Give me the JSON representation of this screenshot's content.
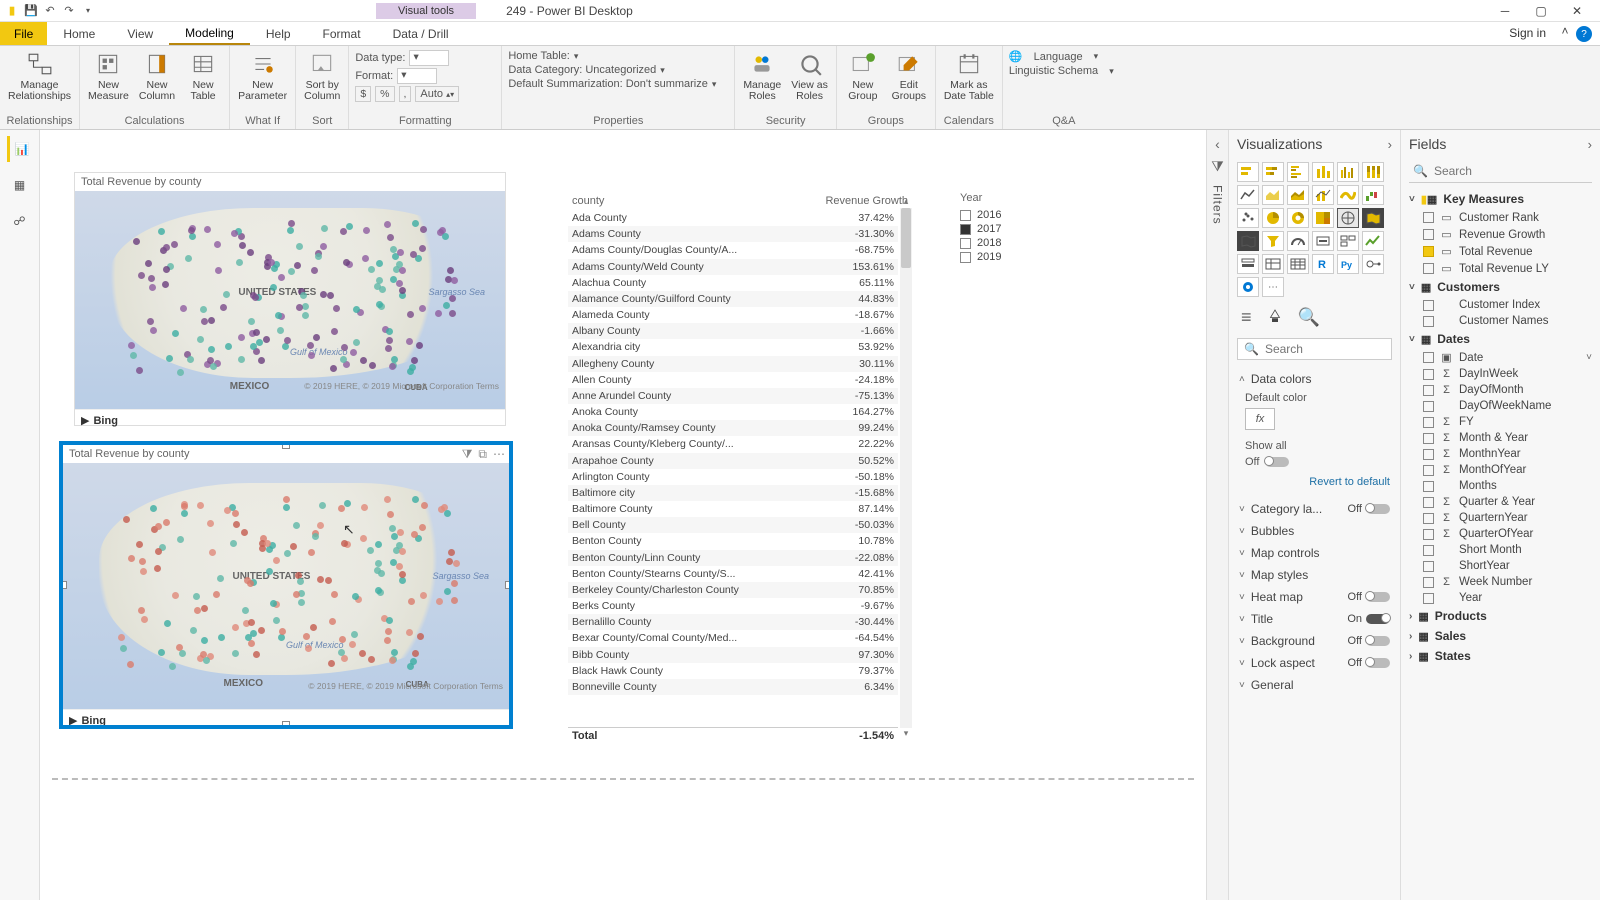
{
  "app_title": "249 - Power BI Desktop",
  "context_tab": "Visual tools",
  "signin": "Sign in",
  "menus": [
    "Home",
    "View",
    "Modeling",
    "Help",
    "Format",
    "Data / Drill"
  ],
  "active_menu": 2,
  "file_label": "File",
  "ribbon": {
    "relationships": {
      "btn": "Manage\nRelationships",
      "label": "Relationships"
    },
    "calculations": {
      "measure": "New\nMeasure",
      "column": "New\nColumn",
      "table": "New\nTable",
      "label": "Calculations"
    },
    "whatif": {
      "btn": "New\nParameter",
      "label": "What If"
    },
    "sort": {
      "btn": "Sort by\nColumn",
      "label": "Sort"
    },
    "formatting": {
      "dt": "Data type:",
      "fmt": "Format:",
      "cur": "$",
      "pct": "%",
      "comma": ",",
      "auto": "Auto",
      "label": "Formatting"
    },
    "properties": {
      "ht": "Home Table:",
      "dc": "Data Category: Uncategorized",
      "ds": "Default Summarization: Don't summarize",
      "label": "Properties"
    },
    "security": {
      "roles": "Manage\nRoles",
      "viewas": "View as\nRoles",
      "label": "Security"
    },
    "groups": {
      "new": "New\nGroup",
      "edit": "Edit\nGroups",
      "label": "Groups"
    },
    "calendars": {
      "btn": "Mark as\nDate Table",
      "label": "Calendars"
    },
    "qa": {
      "lang": "Language",
      "schema": "Linguistic Schema",
      "label": "Q&A"
    }
  },
  "viz_pane_title": "Visualizations",
  "fields_pane_title": "Fields",
  "filters_label": "Filters",
  "search_ph": "Search",
  "format_sections": {
    "data_colors": "Data colors",
    "default_color": "Default color",
    "fx": "fx",
    "show_all": "Show all",
    "off": "Off",
    "on": "On",
    "revert": "Revert to default",
    "category": "Category la...",
    "bubbles": "Bubbles",
    "mapcontrols": "Map controls",
    "mapstyles": "Map styles",
    "heatmap": "Heat map",
    "title": "Title",
    "background": "Background",
    "lock": "Lock aspect",
    "general": "General"
  },
  "fields": {
    "tables": [
      {
        "name": "Key Measures",
        "open": true,
        "accent": true,
        "items": [
          {
            "n": "Customer Rank",
            "ic": "measure"
          },
          {
            "n": "Revenue Growth",
            "ic": "measure"
          },
          {
            "n": "Total Revenue",
            "ic": "measure",
            "sel": true
          },
          {
            "n": "Total Revenue LY",
            "ic": "measure"
          }
        ]
      },
      {
        "name": "Customers",
        "open": true,
        "items": [
          {
            "n": "Customer Index"
          },
          {
            "n": "Customer Names"
          }
        ]
      },
      {
        "name": "Dates",
        "open": true,
        "hier": true,
        "items": [
          {
            "n": "Date",
            "ic": "cal",
            "expand": true
          },
          {
            "n": "DayInWeek",
            "ic": "sum"
          },
          {
            "n": "DayOfMonth",
            "ic": "sum"
          },
          {
            "n": "DayOfWeekName"
          },
          {
            "n": "FY",
            "ic": "sum"
          },
          {
            "n": "Month & Year",
            "ic": "sum"
          },
          {
            "n": "MonthnYear",
            "ic": "sum"
          },
          {
            "n": "MonthOfYear",
            "ic": "sum"
          },
          {
            "n": "Months"
          },
          {
            "n": "Quarter & Year",
            "ic": "sum"
          },
          {
            "n": "QuarternYear",
            "ic": "sum"
          },
          {
            "n": "QuarterOfYear",
            "ic": "sum"
          },
          {
            "n": "Short Month"
          },
          {
            "n": "ShortYear"
          },
          {
            "n": "Week Number",
            "ic": "sum"
          },
          {
            "n": "Year"
          }
        ]
      },
      {
        "name": "Products",
        "open": false,
        "hier": true
      },
      {
        "name": "Sales",
        "open": false,
        "hier": true
      },
      {
        "name": "States",
        "open": false,
        "hier": true
      }
    ]
  },
  "map1_title": "Total Revenue by county",
  "map2_title": "Total Revenue by county",
  "map_labels": {
    "us": "UNITED STATES",
    "mx": "MEXICO",
    "cuba": "CUBA",
    "sargasso": "Sargasso Sea",
    "gulf": "Gulf of\nMexico"
  },
  "bing": "Bing",
  "map_credits": "© 2019 HERE, © 2019 Microsoft Corporation  Terms",
  "slicer": {
    "title": "Year",
    "opts": [
      {
        "v": "2016"
      },
      {
        "v": "2017",
        "sel": true
      },
      {
        "v": "2018"
      },
      {
        "v": "2019"
      }
    ]
  },
  "table": {
    "h1": "county",
    "h2": "Revenue Growth",
    "rows": [
      [
        "Ada County",
        "37.42%"
      ],
      [
        "Adams County",
        "-31.30%"
      ],
      [
        "Adams County/Douglas County/A...",
        "-68.75%"
      ],
      [
        "Adams County/Weld County",
        "153.61%"
      ],
      [
        "Alachua County",
        "65.11%"
      ],
      [
        "Alamance County/Guilford County",
        "44.83%"
      ],
      [
        "Alameda County",
        "-18.67%"
      ],
      [
        "Albany County",
        "-1.66%"
      ],
      [
        "Alexandria city",
        "53.92%"
      ],
      [
        "Allegheny County",
        "30.11%"
      ],
      [
        "Allen County",
        "-24.18%"
      ],
      [
        "Anne Arundel County",
        "-75.13%"
      ],
      [
        "Anoka County",
        "164.27%"
      ],
      [
        "Anoka County/Ramsey County",
        "99.24%"
      ],
      [
        "Aransas County/Kleberg County/...",
        "22.22%"
      ],
      [
        "Arapahoe County",
        "50.52%"
      ],
      [
        "Arlington County",
        "-50.18%"
      ],
      [
        "Baltimore city",
        "-15.68%"
      ],
      [
        "Baltimore County",
        "87.14%"
      ],
      [
        "Bell County",
        "-50.03%"
      ],
      [
        "Benton County",
        "10.78%"
      ],
      [
        "Benton County/Linn County",
        "-22.08%"
      ],
      [
        "Benton County/Stearns County/S...",
        "42.41%"
      ],
      [
        "Berkeley County/Charleston County",
        "70.85%"
      ],
      [
        "Berks County",
        "-9.67%"
      ],
      [
        "Bernalillo County",
        "-30.44%"
      ],
      [
        "Bexar County/Comal County/Med...",
        "-64.54%"
      ],
      [
        "Bibb County",
        "97.30%"
      ],
      [
        "Black Hawk County",
        "79.37%"
      ],
      [
        "Bonneville County",
        "6.34%"
      ]
    ],
    "total_l": "Total",
    "total_v": "-1.54%"
  }
}
